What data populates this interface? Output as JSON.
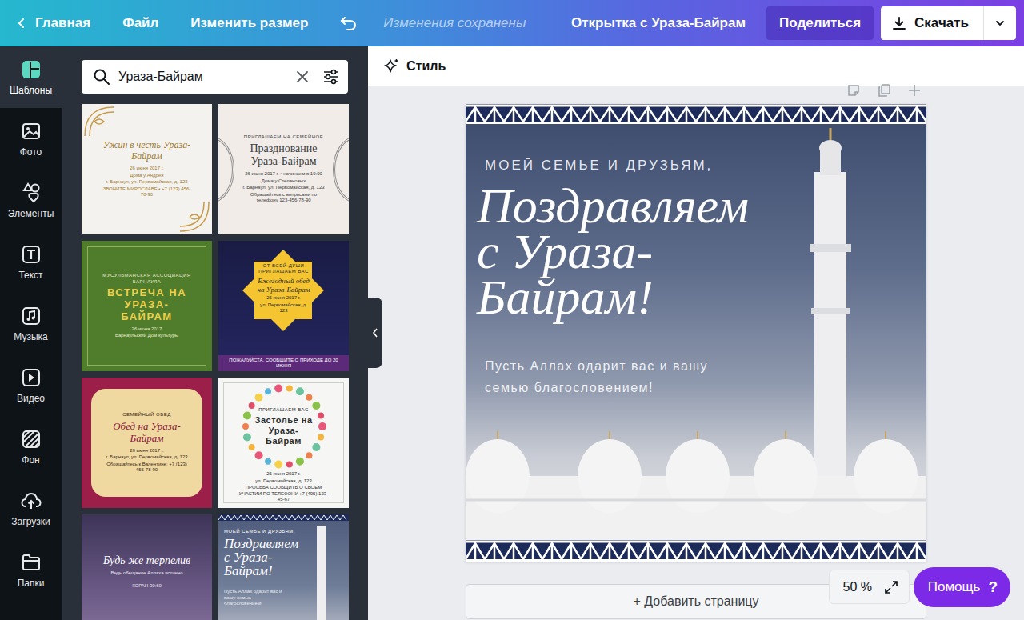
{
  "topbar": {
    "back": "Главная",
    "menu": [
      "Файл",
      "Изменить размер"
    ],
    "status": "Изменения сохранены",
    "title": "Открытка с Ураза-Байрам",
    "share": "Поделиться",
    "download": "Скачать"
  },
  "rail": [
    {
      "label": "Шаблоны",
      "selected": true
    },
    {
      "label": "Фото",
      "selected": false
    },
    {
      "label": "Элементы",
      "selected": false
    },
    {
      "label": "Текст",
      "selected": false
    },
    {
      "label": "Музыка",
      "selected": false
    },
    {
      "label": "Видео",
      "selected": false
    },
    {
      "label": "Фон",
      "selected": false
    },
    {
      "label": "Загрузки",
      "selected": false
    },
    {
      "label": "Папки",
      "selected": false
    }
  ],
  "panel": {
    "search": {
      "value": "Ураза-Байрам"
    },
    "templates": [
      {
        "kind": "paper",
        "kicker": "",
        "title": "Ужин в честь Ураза-Байрам",
        "lines": [
          "26 июня 2017 г.",
          "Дома у Андрея",
          "г. Барнаул, ул. Первомайская, д. 123",
          "ЗВОНИТЕ МИРОСЛАВЕ • +7 (123) 456-78-90"
        ],
        "footer": ""
      },
      {
        "kind": "mandala",
        "kicker": "ПРИГЛАШАЕМ НА СЕМЕЙНОЕ",
        "title": "Празднование Ураза-Байрам",
        "lines": [
          "26 июня 2017 г. • начинаем в 19:00",
          "Дома у Степановых",
          "г. Барнаул, ул. Первомайская, д. 123",
          "Обращайтесь с вопросами по телефону 123-456-78-90"
        ],
        "footer": ""
      },
      {
        "kind": "green",
        "kicker": "МУСУЛЬМАНСКАЯ АССОЦИАЦИЯ БАРНАУЛА",
        "title": "ВСТРЕЧА НА УРАЗА-БАЙРАМ",
        "lines": [
          "26 июня 2017",
          "Барнаульский Дом культуры"
        ],
        "footer": ""
      },
      {
        "kind": "star",
        "kicker": "ОТ ВСЕЙ ДУШИ ПРИГЛАШАЕМ ВАС",
        "title": "Ежегодный обед на Ураза-Байрам",
        "lines": [
          "26 июня 2017 г.",
          "ул. Первомайская, д. 123"
        ],
        "footer": "ПОЖАЛУЙСТА, СООБЩИТЕ О ПРИХОДЕ ДО 20 ИЮНЯ"
      },
      {
        "kind": "frame",
        "kicker": "СЕМЕЙНЫЙ ОБЕД",
        "title": "Обед на Ураза-Байрам",
        "lines": [
          "26 июня 2017 г.",
          "г. Барнаул, ул. Первомайская, д. 123",
          "Обращайтесь к Валентине: +7 (123) 456-78-90"
        ],
        "footer": ""
      },
      {
        "kind": "wreath",
        "kicker": "ПРИГЛАШАЕМ ВАС",
        "title": "Застолье на Ураза-Байрам",
        "lines": [
          "26 июня 2017 г.",
          "ул. Первомайская, д. 123",
          "ПРОСЬБА СООБЩИТЬ О СВОЕМ УЧАСТИИ ПО ТЕЛЕФОНУ +7 (495) 123-45-67"
        ],
        "footer": ""
      },
      {
        "kind": "night",
        "kicker": "",
        "title": "Будь же терпелив",
        "lines": [
          "Ведь обещание Аллаха истинно",
          "КОРАН 30:60"
        ],
        "footer": ""
      },
      {
        "kind": "mosque",
        "kicker": "МОЕЙ СЕМЬЕ И ДРУЗЬЯМ,",
        "title": "Поздравляем с Ураза-Байрам!",
        "lines": [
          "Пусть Аллах одарит вас и вашу семью благословением!"
        ],
        "footer": ""
      }
    ]
  },
  "editor": {
    "style": "Стиль",
    "design": {
      "kicker": "МОЕЙ СЕМЬЕ И ДРУЗЬЯМ,",
      "heading": [
        "Поздравляем",
        "с Ураза-",
        "Байрам!"
      ],
      "blessing": "Пусть Аллах одарит вас и вашу семью благословением!"
    },
    "add_page": "+ Добавить страницу",
    "zoom": "50 %",
    "help": {
      "label": "Помощь",
      "icon": "?"
    }
  }
}
